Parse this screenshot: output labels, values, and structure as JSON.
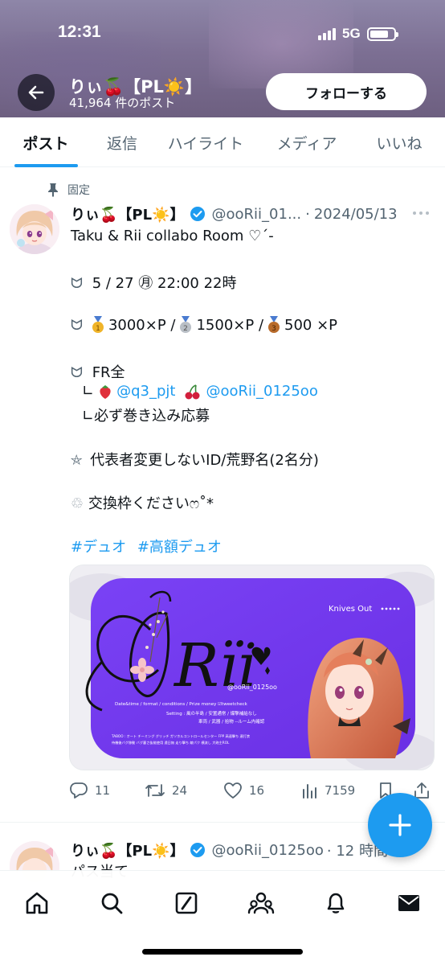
{
  "status_bar": {
    "time": "12:31",
    "network": "5G"
  },
  "profile": {
    "name": "りぃ🍒【PL☀️】",
    "post_count": "41,964 件のポスト",
    "follow_label": "フォローする"
  },
  "tabs": [
    {
      "label": "ポスト",
      "active": true
    },
    {
      "label": "返信"
    },
    {
      "label": "ハイライト"
    },
    {
      "label": "メディア"
    },
    {
      "label": "いいね"
    }
  ],
  "pinned_tweet": {
    "pinned_label": "固定",
    "author_name": "りぃ🍒【PL☀️】",
    "handle": "@ooRii_01...",
    "date": "2024/05/13",
    "lines": {
      "title": "Taku & Rii collabo Room ♡´-",
      "date_line": "5 / 27 ㊊ 22:00  22時",
      "prize_1": "3000×P /",
      "prize_2": "1500×P /",
      "prize_3": "500 ×P",
      "fr_label": "FR全",
      "mention_prefix": "∟",
      "mention_1": "@q3_pjt",
      "mention_2": "@ooRii_0125oo",
      "repost_note": "∟必ず巻き込み応募",
      "notice": "代表者変更しないID/荒野名(2名分)",
      "exchange": "交換枠くださいෆ˚*",
      "hashtag_1": "#デュオ",
      "hashtag_2": "#高額デュオ"
    },
    "media": {
      "knives_out": "Knives Out",
      "brand": "Rïi",
      "handle_text": "@ooRii_0125oo",
      "info_1": "Date&time / format / conditions / Prize money ☑tweetcheck",
      "info_2": "Setting : 風の半島 / 安置通常 / 爆撃補給なし",
      "info_3": "車両 / 武器 / 拾物 --ルーム内確認",
      "info_4": "TABOO : オート チーミング グリッチ ガソホルコントロールセンター FPP 高速撃ち 連打禁",
      "info_5": "待機後バグ移動 バグ裏さ抜能使用 遠日無 走り撃ち 敵パク 横流し 大砲主ROL"
    },
    "stats": {
      "replies": "11",
      "reposts": "24",
      "likes": "16",
      "views": "7159"
    }
  },
  "second_tweet": {
    "author_name": "りぃ🍒【PL☀️】",
    "handle": "@ooRii_0125oo",
    "time": "· 12 時間",
    "text": "パス当て"
  },
  "colors": {
    "accent": "#1d9bf0",
    "media_purple": "#7b3ff2"
  },
  "nav_icons": [
    "home-icon",
    "search-icon",
    "grok-icon",
    "communities-icon",
    "notifications-icon",
    "messages-icon"
  ]
}
